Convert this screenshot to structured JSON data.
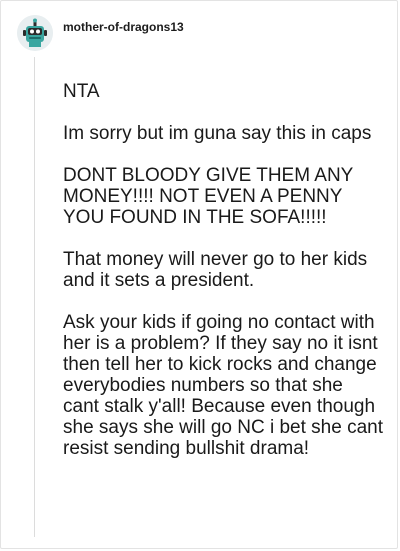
{
  "comment": {
    "username": "mother-of-dragons13",
    "paragraphs": [
      "NTA",
      "Im sorry but im guna say this in caps",
      "DONT BLOODY GIVE THEM ANY MONEY!!!! NOT EVEN A PENNY YOU FOUND IN THE SOFA!!!!!",
      "That money will never go to her kids and it sets a president.",
      "Ask your kids if going no contact with her is a problem? If they say no it isnt then tell her to kick rocks and change everybodies numbers so that she cant stalk y'all! Because even though she says she will go NC i bet she cant resist sending bullshit drama!"
    ]
  }
}
